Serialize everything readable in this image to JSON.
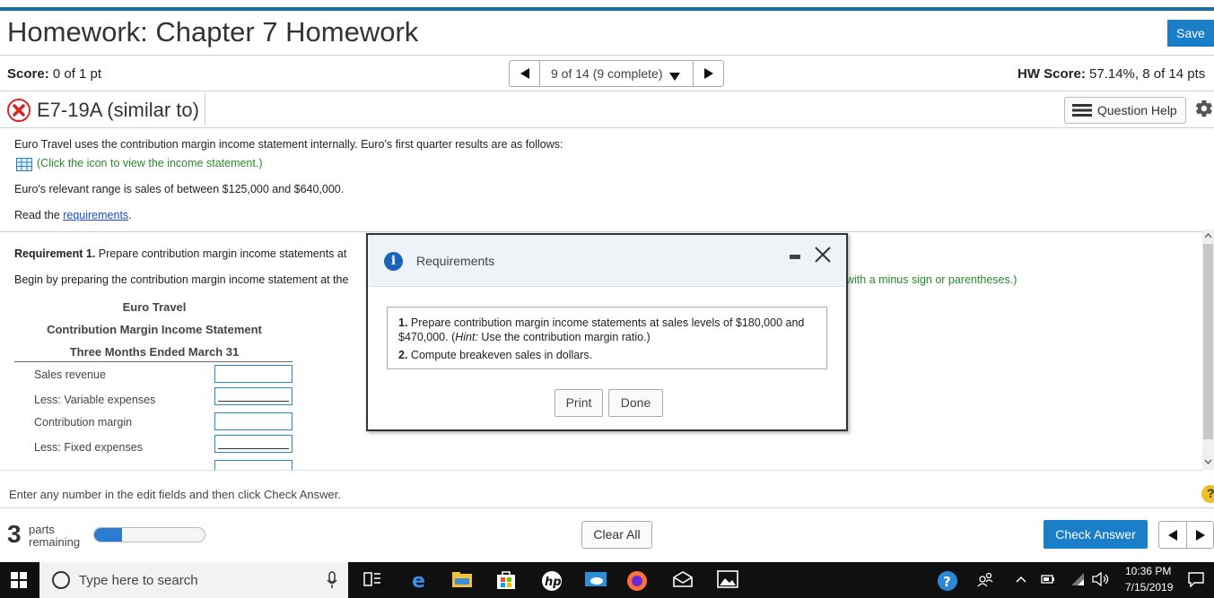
{
  "header": {
    "title": "Homework: Chapter 7 Homework",
    "save_label": "Save"
  },
  "scorebar": {
    "score_label": "Score:",
    "score_value": "0 of 1 pt",
    "nav_label": "9 of 14 (9 complete)",
    "hw_label": "HW Score:",
    "hw_value": "57.14%, 8 of 14 pts"
  },
  "question": {
    "title": "E7-19A (similar to)",
    "help_label": "Question Help"
  },
  "body": {
    "intro": "Euro Travel uses the contribution margin income statement internally. Euro's first quarter results are as follows:",
    "click_icon": "(Click the icon to view the income statement.)",
    "range": "Euro's relevant range is sales of between $125,000 and $640,000.",
    "read_prefix": "Read the",
    "read_link": "requirements",
    "read_suffix": ".",
    "req1_label": "Requirement 1.",
    "req1_text": "Prepare contribution margin income statements at",
    "begin_text": "Begin by preparing the contribution margin income statement at the",
    "minus_text": "with a minus sign or parentheses.)"
  },
  "statement": {
    "company": "Euro Travel",
    "title": "Contribution Margin Income Statement",
    "period": "Three Months Ended March 31",
    "rows": [
      {
        "label": "Sales revenue"
      },
      {
        "label": "Less: Variable expenses"
      },
      {
        "label": "Contribution margin"
      },
      {
        "label": "Less: Fixed expenses"
      }
    ]
  },
  "footer": {
    "enter_msg": "Enter any number in the edit fields and then click Check Answer.",
    "parts_count": "3",
    "parts_word": "parts",
    "parts_remaining": "remaining",
    "progress_fraction": 0.25,
    "clear_label": "Clear All",
    "check_label": "Check Answer"
  },
  "modal": {
    "title": "Requirements",
    "items": [
      {
        "num": "1.",
        "text_pre": "Prepare contribution margin income statements at sales levels of $180,000 and $470,000. (",
        "hint_label": "Hint:",
        "text_post": " Use the contribution margin ratio.)"
      },
      {
        "num": "2.",
        "text": "Compute breakeven sales in dollars."
      }
    ],
    "print_label": "Print",
    "done_label": "Done"
  },
  "taskbar": {
    "search_placeholder": "Type here to search",
    "time": "10:36 PM",
    "date": "7/15/2019"
  },
  "colors": {
    "accent": "#1a7ec8",
    "header_line": "#1e6d9e",
    "link": "#1a4dcc",
    "green_hint": "#2a8a2a",
    "error": "#dd2222"
  }
}
